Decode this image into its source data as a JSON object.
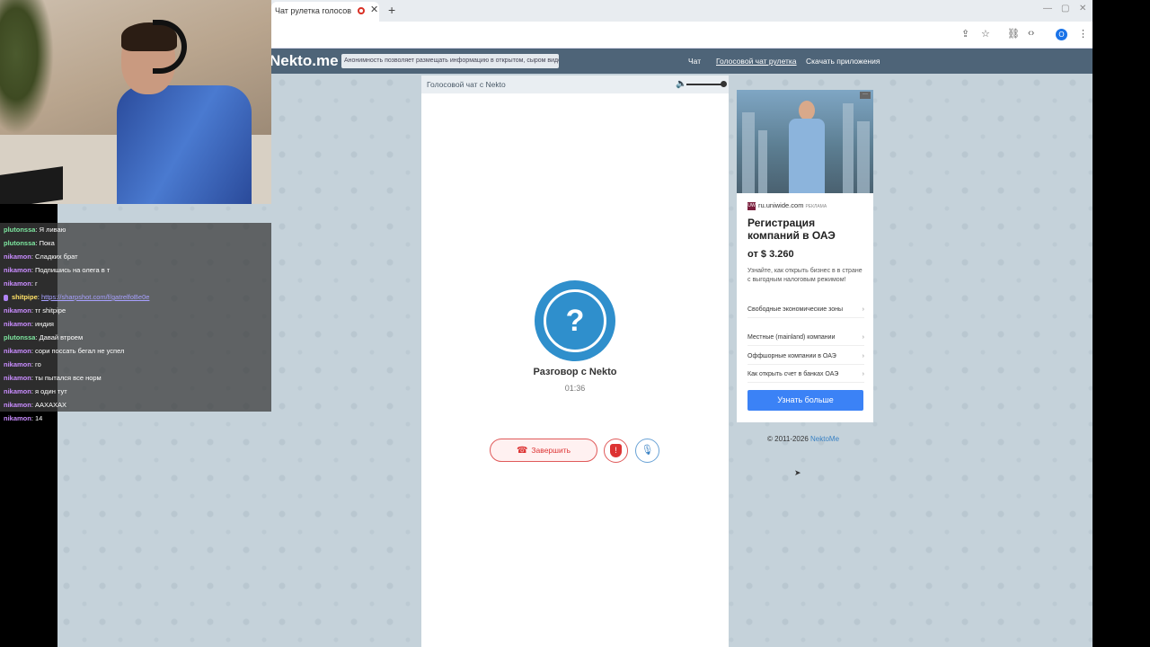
{
  "browser": {
    "tab_title": "Чат рулетка голосов",
    "tab_close": "✕",
    "new_tab": "+",
    "win_min": "—",
    "win_max": "▢",
    "win_close": "✕",
    "profile_initial": "O"
  },
  "site": {
    "logo": "Nekto.me",
    "notice": "Анонимность позволяет размещать информацию в открытом, сыром виде!",
    "nav": {
      "chat": "Чат",
      "voice": "Голосовой чат рулетка",
      "download": "Скачать приложения"
    }
  },
  "chat_panel": {
    "header": "Голосовой чат с Nekto",
    "avatar_symbol": "?",
    "title": "Разговор с Nekto",
    "timer": "01:36",
    "end_button": "Завершить",
    "report_symbol": "!"
  },
  "ad": {
    "domain": "ru.uniwide.com",
    "ad_tag": "РЕКЛАМА",
    "logo_text": "UW",
    "title": "Регистрация компаний в ОАЭ",
    "price": "от $ 3.260",
    "description": "Узнайте, как открыть бизнес в в стране с выгодным налоговым режимом!",
    "links": [
      "Свободные экономические зоны",
      "Местные (mainland) компании",
      "Оффшорные компании в ОАЭ",
      "Как открыть счет в банках ОАЭ"
    ],
    "cta": "Узнать больше",
    "menu": "···"
  },
  "footer": {
    "copyright": "© 2011-2026",
    "brand": "NektoMe"
  },
  "chat_overlay": {
    "messages": [
      {
        "user": "plutonssa",
        "text": ": Я ливаю",
        "color": "#7ee8a0"
      },
      {
        "user": "plutonssa",
        "text": ": Пока",
        "color": "#7ee8a0"
      },
      {
        "user": "nikamon",
        "text": ": Сладких брат",
        "color": "#c98cff"
      },
      {
        "user": "nikamon",
        "text": ": Подпишись на олега в т",
        "color": "#c98cff"
      },
      {
        "user": "nikamon",
        "text": ": г",
        "color": "#c98cff"
      },
      {
        "user": "shitpipe",
        "text": ": ",
        "link": "https://sharpshot.com/f/gatrelfoBe0e",
        "color": "#ffe066",
        "badge": true
      },
      {
        "user": "nikamon",
        "text": ": тг shitpipe",
        "color": "#c98cff"
      },
      {
        "user": "nikamon",
        "text": ": индия",
        "color": "#c98cff"
      },
      {
        "user": "plutonssa",
        "text": ": Давай втроем",
        "color": "#7ee8a0"
      },
      {
        "user": "nikamon",
        "text": ": сори поссать бегал не успел",
        "color": "#c98cff"
      },
      {
        "user": "nikamon",
        "text": ": го",
        "color": "#c98cff"
      },
      {
        "user": "nikamon",
        "text": ": ты пытался все норм",
        "color": "#c98cff"
      },
      {
        "user": "nikamon",
        "text": ": я один тут",
        "color": "#c98cff"
      },
      {
        "user": "nikamon",
        "text": ": ААХАХАХ",
        "color": "#c98cff"
      },
      {
        "user": "nikamon",
        "text": ": 14",
        "color": "#c98cff"
      }
    ]
  }
}
